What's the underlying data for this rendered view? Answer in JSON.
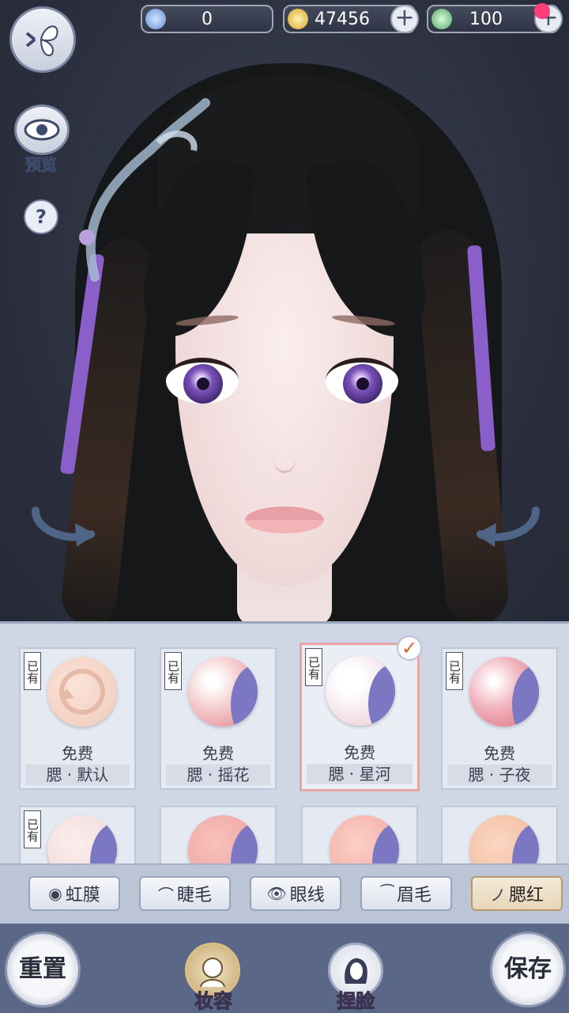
{
  "header": {
    "currency1": {
      "icon": "jade-icon",
      "value": "0"
    },
    "currency2": {
      "icon": "coin-icon",
      "value": "47456"
    },
    "currency3": {
      "icon": "stamina-icon",
      "value": "100"
    }
  },
  "left_controls": {
    "preview_label": "预览",
    "help_symbol": "?"
  },
  "cards": [
    {
      "owned": "已有",
      "price": "免费",
      "name": "腮 · 默认",
      "selected": false
    },
    {
      "owned": "已有",
      "price": "免费",
      "name": "腮 · 摇花",
      "selected": false
    },
    {
      "owned": "已有",
      "price": "免费",
      "name": "腮 · 星河",
      "selected": true
    },
    {
      "owned": "已有",
      "price": "免费",
      "name": "腮 · 子夜",
      "selected": false
    },
    {
      "owned": "已有"
    }
  ],
  "tabs": [
    {
      "label": "虹膜",
      "icon": "iris-icon",
      "active": false
    },
    {
      "label": "睫毛",
      "icon": "eyelash-icon",
      "active": false
    },
    {
      "label": "眼线",
      "icon": "eyeliner-icon",
      "active": false
    },
    {
      "label": "眉毛",
      "icon": "eyebrow-icon",
      "active": false
    },
    {
      "label": "腮红",
      "icon": "blush-icon",
      "active": true
    }
  ],
  "bottom_nav": {
    "reset_label": "重置",
    "makeup_label": "妆容",
    "face_label": "捏脸",
    "save_label": "保存"
  },
  "colors": {
    "selected_border": "#e7a5a5",
    "accent_check": "#e0662b",
    "panel_bg": "#cfd6e4"
  }
}
